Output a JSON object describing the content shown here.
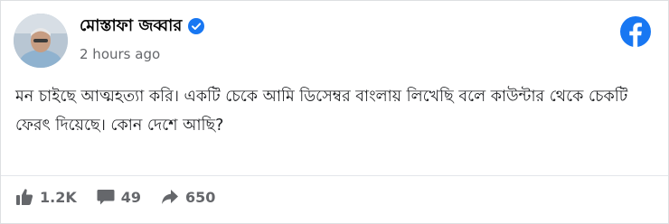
{
  "post": {
    "author": "মোস্তাফা জব্বার",
    "time": "2 hours ago",
    "text": "মন চাইছে আত্মহত্যা করি। একটি চেকে আমি ডিসেম্বর বাংলায় লিখেছি বলে কাউন্টার থেকে চেকটি ফেরৎ দিয়েছে। কোন দেশে আছি?"
  },
  "stats": {
    "likes": "1.2K",
    "comments": "49",
    "shares": "650"
  },
  "colors": {
    "brand": "#1877f2",
    "muted": "#65676b"
  },
  "icons": [
    "verified-badge-icon",
    "facebook-logo-icon",
    "like-icon",
    "comment-icon",
    "share-icon"
  ]
}
